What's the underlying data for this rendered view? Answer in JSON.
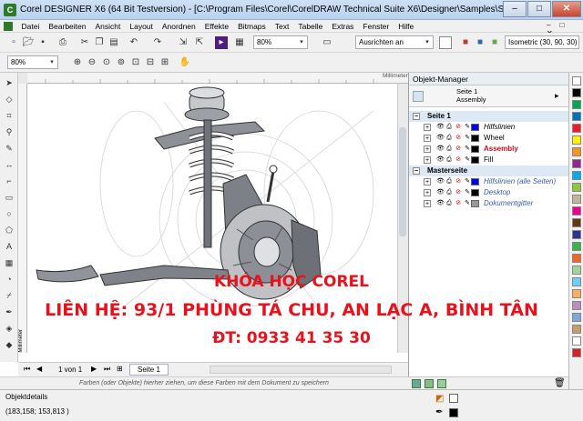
{
  "window": {
    "title": "Corel DESIGNER X6 (64 Bit Testversion) - [C:\\Program Files\\Corel\\CorelDRAW Technical Suite X6\\Designer\\Samples\\Sample3...",
    "min": "–",
    "max": "□",
    "close": "✕"
  },
  "menu": [
    "Datei",
    "Bearbeiten",
    "Ansicht",
    "Layout",
    "Anordnen",
    "Effekte",
    "Bitmaps",
    "Text",
    "Tabelle",
    "Extras",
    "Fenster",
    "Hilfe"
  ],
  "toolbar": {
    "zoom1": "80%",
    "snap": "Ausrichten an",
    "projection": "Isometric (30, 90, 30)",
    "zoom2": "80%"
  },
  "ruler": {
    "unit": "Millimeter",
    "unit_left": "Millimeter"
  },
  "pages": {
    "nav_text": "1 von 1",
    "tab": "Seite 1"
  },
  "hint": "Farben (oder Objekte) hierher ziehen, um diese Farben mit dem Dokument zu speichern",
  "status": {
    "details": "Objektdetails",
    "coords": "(183,158; 153,813 )"
  },
  "object_manager": {
    "title": "Objekt-Manager",
    "page_label": "Seite 1",
    "layer_label": "Assembly",
    "rows": [
      {
        "kind": "group",
        "label": "Seite 1"
      },
      {
        "kind": "layer",
        "label": "Hilfslinien",
        "style": "italic",
        "color": "#0000ff"
      },
      {
        "kind": "layer",
        "label": "Wheel",
        "style": "normal",
        "color": "#000000"
      },
      {
        "kind": "layer",
        "label": "Assembly",
        "style": "bold-red",
        "color": "#000000"
      },
      {
        "kind": "layer",
        "label": "Fill",
        "style": "normal",
        "color": "#000000"
      },
      {
        "kind": "group",
        "label": "Masterseite"
      },
      {
        "kind": "layer",
        "label": "Hilfslinien (alle Seiten)",
        "style": "italic-blue",
        "color": "#0000ff"
      },
      {
        "kind": "layer",
        "label": "Desktop",
        "style": "italic-blue",
        "color": "#000000"
      },
      {
        "kind": "layer",
        "label": "Dokumentgitter",
        "style": "italic-blue",
        "color": "#999999"
      }
    ]
  },
  "overlay": {
    "line1": "KHÓA HỌC COREL",
    "line2": "LIÊN HỆ: 93/1 PHÙNG TÁ CHU, AN LẠC A, BÌNH TÂN",
    "line3": "ĐT: 0933 41 35 30",
    "color": "#e8121c"
  },
  "palette": [
    "#ffffff",
    "#000000",
    "#00a651",
    "#0072bc",
    "#ed1c24",
    "#fff200",
    "#f7941d",
    "#92278f",
    "#00aeef",
    "#8dc63f",
    "#c2b59b",
    "#ec008c",
    "#603913",
    "#2e3192",
    "#39b54a",
    "#f26522",
    "#a3d39c",
    "#6dcff6",
    "#fbaf5d",
    "#bd8cbf",
    "#7da7d9",
    "#c69c6d",
    "#ffffff",
    "#d2232a"
  ]
}
